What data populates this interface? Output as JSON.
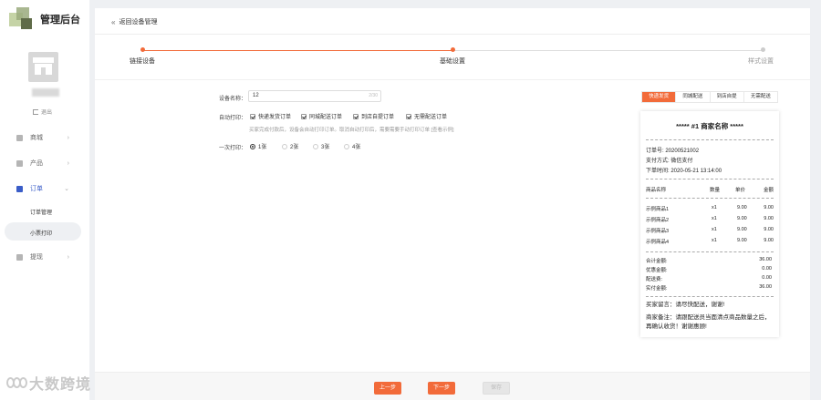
{
  "app": {
    "title": "管理后台"
  },
  "sidebar": {
    "logout": "退出",
    "menu": [
      {
        "label": "商城",
        "icon": "shop-icon"
      },
      {
        "label": "产品",
        "icon": "product-icon"
      },
      {
        "label": "订单",
        "icon": "order-icon"
      },
      {
        "label": "提现",
        "icon": "withdraw-icon"
      }
    ],
    "submenu": [
      "订单管理",
      "小票打印"
    ]
  },
  "header": {
    "back_label": "返回设备管理"
  },
  "steps": [
    "链接设备",
    "基础设置",
    "样式设置"
  ],
  "form": {
    "name_label": "设备名称：",
    "name_value": "12",
    "name_counter": "2/30",
    "auto_print_label": "自动打印：",
    "auto_print_options": [
      "快递发货订单",
      "同城配送订单",
      "到店自提订单",
      "无需配送订单"
    ],
    "hint": "买家完成付款后，设备会自动打印订单。取消自动打印后，需要需要手动打印订单 [查看示例]",
    "copies_label": "一次打印：",
    "copies_options": [
      "1张",
      "2张",
      "3张",
      "4张"
    ],
    "copies_selected": "1张"
  },
  "preview": {
    "tabs": [
      "快递发货",
      "同城配送",
      "到店自提",
      "无需配送"
    ],
    "active_tab": "快递发货",
    "receipt": {
      "title": "***** #1 商家名称 *****",
      "order_no": "订单号: 20200521002",
      "pay_method": "支付方式: 微信支付",
      "order_time": "下单时间: 2020-05-21 13:14:00",
      "columns": [
        "商品名称",
        "数量",
        "单价",
        "金额"
      ],
      "items": [
        [
          "示例商品1",
          "x1",
          "9.00",
          "9.00"
        ],
        [
          "示例商品2",
          "x1",
          "9.00",
          "9.00"
        ],
        [
          "示例商品3",
          "x1",
          "9.00",
          "9.00"
        ],
        [
          "示例商品4",
          "x1",
          "9.00",
          "9.00"
        ]
      ],
      "summary": [
        [
          "合计金额:",
          "36.00"
        ],
        [
          "优惠金额:",
          "0.00"
        ],
        [
          "配送费:",
          "0.00"
        ],
        [
          "实付金额:",
          "36.00"
        ]
      ],
      "buyer_msg": "买家留言：请尽快配送，谢谢!",
      "seller_note": "商家备注：请跟配送员当面清点商品数量之后，再确认收货！谢谢惠顾!"
    }
  },
  "footer": {
    "prev": "上一步",
    "next": "下一步",
    "save": "保存"
  },
  "watermark": "大数跨境",
  "colors": {
    "accent": "#f26b3a",
    "active_menu": "#3a5dc8"
  }
}
